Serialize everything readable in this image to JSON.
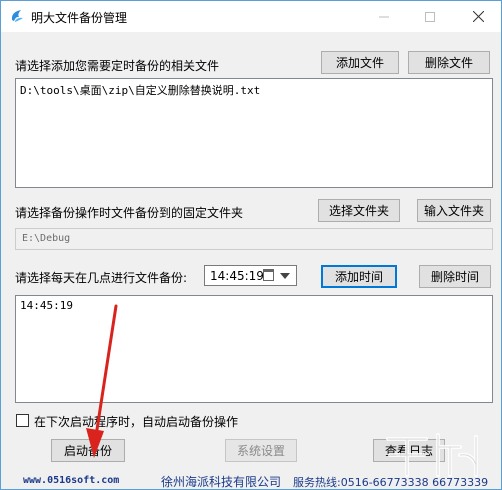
{
  "window": {
    "title": "明大文件备份管理",
    "minimize_icon": "minimize-icon",
    "maximize_icon": "maximize-icon",
    "close_icon": "close-icon"
  },
  "files_section": {
    "label": "请选择添加您需要定时备份的相关文件",
    "add_button": "添加文件",
    "delete_button": "删除文件",
    "items": [
      "D:\\tools\\桌面\\zip\\自定义删除替换说明.txt"
    ]
  },
  "folder_section": {
    "label": "请选择备份操作时文件备份到的固定文件夹",
    "select_button": "选择文件夹",
    "input_button": "输入文件夹",
    "path": "E:\\Debug"
  },
  "time_section": {
    "label": "请选择每天在几点进行文件备份:",
    "time_value": "14:45:19",
    "add_button": "添加时间",
    "delete_button": "删除时间",
    "items": [
      "14:45:19"
    ]
  },
  "options": {
    "autostart_label": "在下次启动程序时，自动启动备份操作",
    "autostart_checked": false
  },
  "actions": {
    "start_button": "启动备份",
    "settings_button": "系统设置",
    "log_button": "查看日志"
  },
  "footer": {
    "url": "www.0516soft.com",
    "company": "徐州海派科技有限公司",
    "hotline": "服务热线:0516-66773338 66773339"
  },
  "colors": {
    "accent": "#0078d7",
    "annotation_arrow": "#d9231c",
    "footer_text": "#1a3a8a"
  }
}
